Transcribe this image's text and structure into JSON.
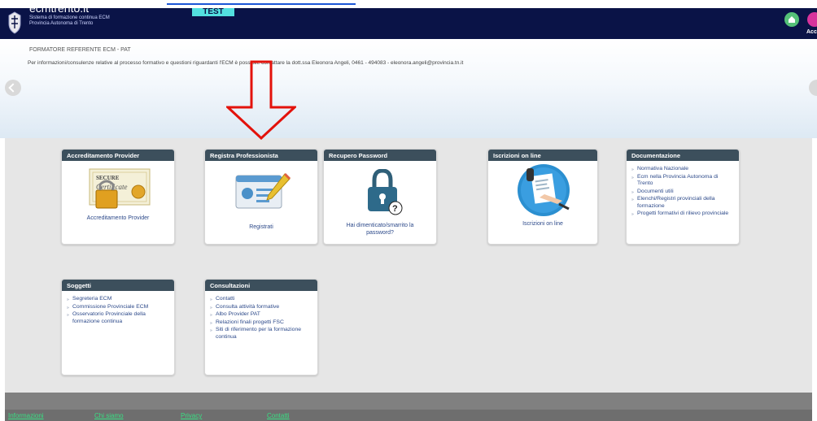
{
  "header": {
    "site_name": "ecmtrento.it",
    "site_subtitle_1": "Sistema di formazione continua ECM",
    "site_subtitle_2": "Provincia Autonoma di Trento",
    "test_badge": "TEST",
    "account_label": "Acc"
  },
  "hero": {
    "referente_title": "FORMATORE REFERENTE ECM - PAT",
    "referente_info": "Per informazioni/consulenze relative al processo formativo e questioni riguardanti l'ECM è possibile contattare la dott.ssa Eleonora Angeli, 0461 - 494083 - eleonora.angeli@provincia.tn.it"
  },
  "cards": {
    "accreditamento": {
      "title": "Accreditamento Provider",
      "caption": "Accreditamento Provider",
      "icon": "certificate-icon"
    },
    "registra": {
      "title": "Registra Professionista",
      "caption": "Registrati",
      "icon": "id-card-icon"
    },
    "recupero": {
      "title": "Recupero Password",
      "caption_1": "Hai dimenticato/smarrito la",
      "caption_2": "password?",
      "icon": "padlock-icon"
    },
    "iscrizioni": {
      "title": "Iscrizioni on line",
      "caption": "Iscrizioni on line",
      "icon": "signing-document-icon"
    },
    "documentazione": {
      "title": "Documentazione",
      "items": [
        "Normativa Nazionale",
        "Ecm nella Provincia Autonoma di Trento",
        "Documenti utili",
        "Elenchi/Registri provinciali della formazione",
        "Progetti formativi di rilievo provinciale"
      ]
    },
    "soggetti": {
      "title": "Soggetti",
      "items": [
        "Segreteria ECM",
        "Commissione Provinciale ECM",
        "Osservatorio Provinciale della formazione continua"
      ]
    },
    "consultazioni": {
      "title": "Consultazioni",
      "items": [
        "Contatti",
        "Consulta attività formative",
        "Albo Provider PAT",
        "Relazioni finali progetti FSC",
        "Siti di riferimento per la formazione continua"
      ]
    }
  },
  "footer": {
    "links": [
      "Informazioni",
      "Chi siamo",
      "Privacy",
      "Contatti"
    ]
  },
  "colors": {
    "topbar": "#0a1347",
    "card_header": "#3c4f5c",
    "link_text": "#2d4a8a",
    "footer_link": "#38e083",
    "annotation_arrow": "#e3120b"
  }
}
